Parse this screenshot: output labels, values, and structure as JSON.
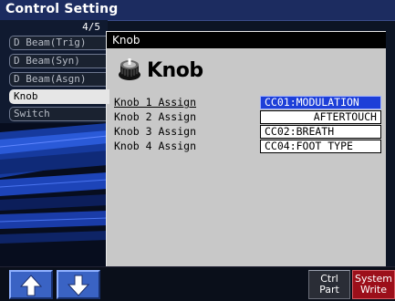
{
  "window": {
    "title": "Control Setting",
    "page_counter": "4/5"
  },
  "tabs": [
    {
      "label": "D Beam(Trig)",
      "active": false
    },
    {
      "label": "D Beam(Syn)",
      "active": false
    },
    {
      "label": "D Beam(Asgn)",
      "active": false
    },
    {
      "label": "Knob",
      "active": true
    },
    {
      "label": "Switch",
      "active": false
    }
  ],
  "panel": {
    "title": "Knob",
    "heading": "Knob",
    "heading_icon": "knob-icon",
    "rows": [
      {
        "label": "Knob 1 Assign",
        "value": "CC01:MODULATION",
        "selected": true
      },
      {
        "label": "Knob 2 Assign",
        "value": "AFTERTOUCH",
        "selected": false
      },
      {
        "label": "Knob 3 Assign",
        "value": "CC02:BREATH",
        "selected": false
      },
      {
        "label": "Knob 4 Assign",
        "value": "CC04:FOOT TYPE",
        "selected": false
      }
    ]
  },
  "footer": {
    "up_icon": "arrow-up-icon",
    "down_icon": "arrow-down-icon",
    "ctrl_part": {
      "line1": "Ctrl",
      "line2": "Part"
    },
    "system_write": {
      "line1": "System",
      "line2": "Write"
    }
  },
  "colors": {
    "title_bar": "#1c2c60",
    "panel_bg": "#c8c8c8",
    "selected_value": "#1d3fd8",
    "arrow_button": "#3a63c4",
    "write_button": "#9c0f1a"
  }
}
